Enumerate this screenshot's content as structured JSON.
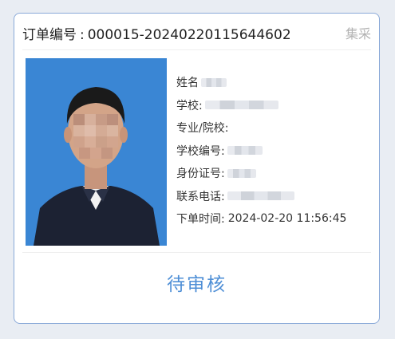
{
  "order": {
    "label": "订单编号",
    "separator": ":",
    "number": "000015-20240220115644602",
    "tag": "集采"
  },
  "fields": {
    "name_label": "姓名",
    "school_label": "学校:",
    "major_label": "专业/院校:",
    "school_code_label": "学校编号:",
    "id_label": "身份证号:",
    "phone_label": "联系电话:",
    "order_time_label": "下单时间:",
    "order_time_value": "2024-02-20 11:56:45"
  },
  "status": "待审核",
  "colors": {
    "photo_background": "#3a86d4",
    "accent": "#4f8fd6",
    "border": "#8aa9d8"
  }
}
